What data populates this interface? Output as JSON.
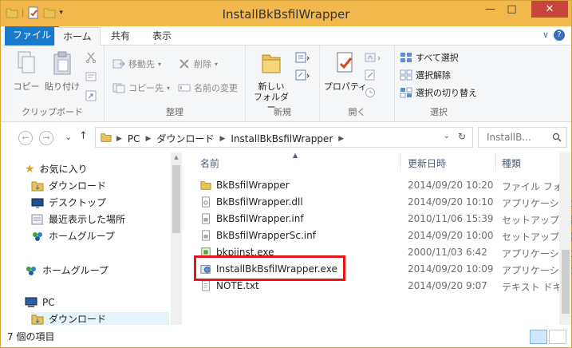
{
  "window": {
    "title": "InstallBkBsfilWrapper",
    "controls": {
      "minimize": "—",
      "maximize": "□",
      "close": "✕"
    },
    "accent_color": "#f2b84b",
    "close_color": "#c7463b"
  },
  "ribbon_tabs": {
    "file": "ファイル",
    "home": "ホーム",
    "share": "共有",
    "view": "表示",
    "right_icons": {
      "expand": "∨",
      "help": "?"
    }
  },
  "ribbon": {
    "clipboard": {
      "label": "クリップボード",
      "copy": "コピー",
      "paste": "貼り付け"
    },
    "organize": {
      "label": "整理",
      "move_to": "移動先",
      "copy_to": "コピー先",
      "delete": "削除",
      "rename": "名前の変更"
    },
    "new": {
      "label": "新規",
      "new_folder_line1": "新しい",
      "new_folder_line2": "フォルダー"
    },
    "open": {
      "label": "開く",
      "properties": "プロパティ"
    },
    "select": {
      "label": "選択",
      "select_all": "すべて選択",
      "select_none": "選択解除",
      "invert": "選択の切り替え"
    }
  },
  "address": {
    "crumbs": [
      "PC",
      "ダウンロード",
      "InstallBkBsfilWrapper"
    ],
    "search_placeholder": "InstallB..."
  },
  "nav_pane": {
    "favorites": "お気に入り",
    "downloads": "ダウンロード",
    "desktop": "デスクトップ",
    "recent": "最近表示した場所",
    "homegroup_fav": "ホームグループ",
    "homegroup": "ホームグループ",
    "pc": "PC",
    "pc_downloads": "ダウンロード"
  },
  "file_list": {
    "columns": {
      "name": "名前",
      "date": "更新日時",
      "type": "種類"
    },
    "rows": [
      {
        "name": "BkBsfilWrapper",
        "date": "2014/09/20 10:20",
        "type": "ファイル フォルダー",
        "icon": "folder-icon"
      },
      {
        "name": "BkBsfilWrapper.dll",
        "date": "2014/09/20 10:10",
        "type": "アプリケーション拡",
        "icon": "dll-icon"
      },
      {
        "name": "BkBsfilWrapper.inf",
        "date": "2010/11/06 15:39",
        "type": "セットアップ情報",
        "icon": "inf-icon"
      },
      {
        "name": "BkBsfilWrapperSc.inf",
        "date": "2014/09/20 10:00",
        "type": "セットアップ情報",
        "icon": "inf-icon"
      },
      {
        "name": "bkpiinst.exe",
        "date": "2000/11/03 6:42",
        "type": "アプリケーション",
        "icon": "exe-icon"
      },
      {
        "name": "InstallBkBsfilWrapper.exe",
        "date": "2014/09/20 10:09",
        "type": "アプリケーション",
        "icon": "installer-icon"
      },
      {
        "name": "NOTE.txt",
        "date": "2014/09/20 9:07",
        "type": "テキスト ドキュメン",
        "icon": "text-file-icon"
      }
    ],
    "highlight_color": "#e8141c"
  },
  "status": {
    "item_count": "7 個の項目"
  }
}
